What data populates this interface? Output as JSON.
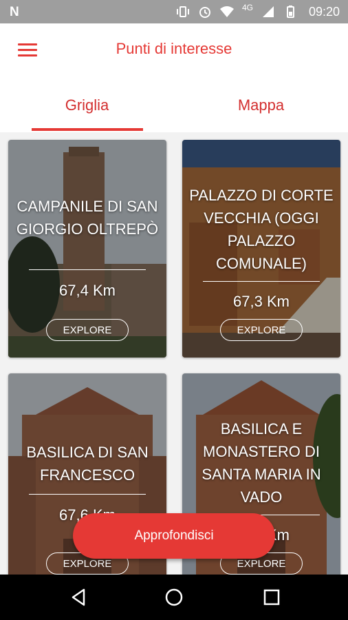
{
  "status_bar": {
    "left_icon": "N",
    "network": "4G",
    "time": "09:20",
    "icons": [
      "vibrate-icon",
      "alarm-icon",
      "wifi-icon",
      "cell-signal-icon",
      "battery-icon"
    ]
  },
  "app_bar": {
    "title": "Punti di interesse",
    "accent_color": "#e53935"
  },
  "tabs": [
    {
      "label": "Griglia",
      "selected": true
    },
    {
      "label": "Mappa",
      "selected": false
    }
  ],
  "cards": [
    {
      "title": "CAMPANILE DI SAN GIORGIO OLTREPÒ",
      "distance": "67,4 Km",
      "button": "EXPLORE"
    },
    {
      "title": "PALAZZO DI CORTE VECCHIA (OGGI PALAZZO COMUNALE)",
      "distance": "67,3 Km",
      "button": "EXPLORE"
    },
    {
      "title": "BASILICA DI SAN FRANCESCO",
      "distance": "67,6 Km",
      "button": "EXPLORE"
    },
    {
      "title": "BASILICA E MONASTERO DI SANTA MARIA IN VADO",
      "distance": "67,6 Km",
      "button": "EXPLORE"
    }
  ],
  "fab": {
    "label": "Approfondisci"
  },
  "nav_bar": {
    "icons": [
      "back-icon",
      "home-icon",
      "recents-icon"
    ]
  }
}
